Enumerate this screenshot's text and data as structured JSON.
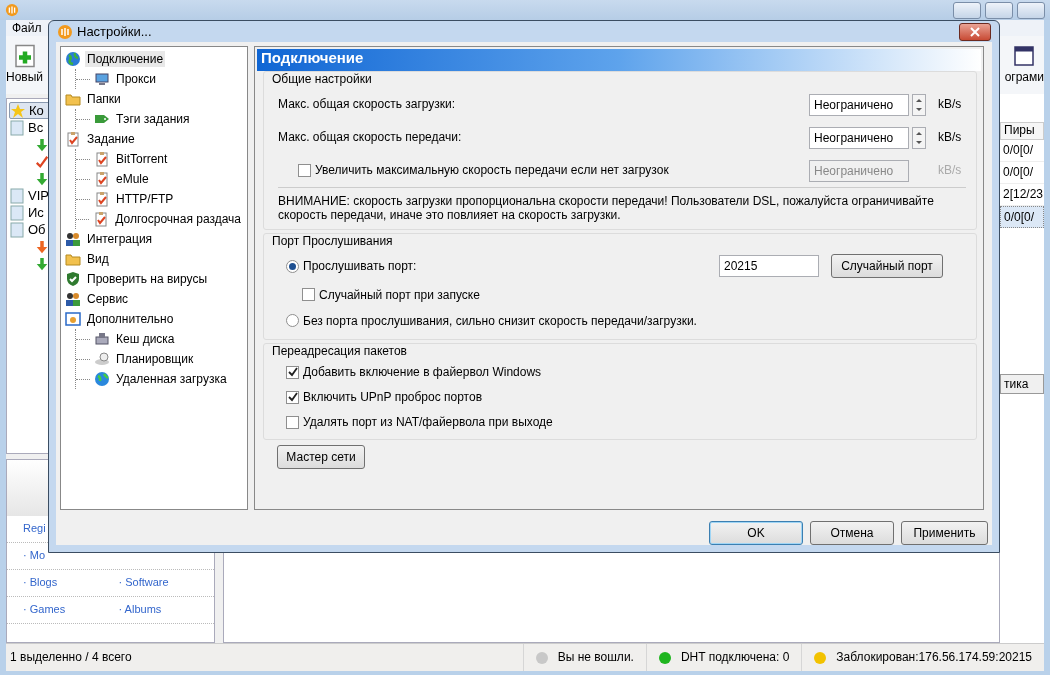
{
  "app": {
    "menu": [
      {
        "label": "Файл"
      }
    ],
    "toolbar": [
      {
        "label": "Новый"
      },
      {
        "label": "ограми"
      }
    ],
    "sidebar": {
      "items": [
        {
          "label": "Ко",
          "selected": true
        },
        {
          "label": "Вс",
          "selected": false
        },
        {
          "label": "VIP",
          "selected": false
        },
        {
          "label": "Ис",
          "selected": false
        },
        {
          "label": "Об",
          "selected": false
        }
      ]
    },
    "table": {
      "columns": [
        {
          "label": "Пиры"
        }
      ],
      "rows": [
        {
          "cell": "0/0[0/",
          "selected": false
        },
        {
          "cell": "0/0[0/",
          "selected": false
        },
        {
          "cell": "2[12/23",
          "selected": false
        },
        {
          "cell": "0/0[0/",
          "selected": true
        }
      ]
    },
    "tab": {
      "label": "тика"
    },
    "links": [
      [
        "Regi"
      ],
      [
        "· Mo"
      ],
      [
        "· Blogs",
        "· Software"
      ],
      [
        "· Games",
        "· Albums"
      ]
    ],
    "status_bar": {
      "selection": "1 выделенно / 4 всего",
      "items": [
        {
          "text": "Вы не вошли.",
          "color": "#c8c8c8"
        },
        {
          "text": "DHT подключена: 0",
          "color": "#1fb51f"
        },
        {
          "text": "Заблокирован:176.56.174.59:20215",
          "color": "#f2c200"
        }
      ]
    }
  },
  "dialog": {
    "title": "Настройки...",
    "tree": [
      {
        "label": "Подключение",
        "selected": true,
        "children": [
          {
            "label": "Прокси",
            "selected": false
          }
        ]
      },
      {
        "label": "Папки",
        "selected": false,
        "children": [
          {
            "label": "Тэги задания",
            "selected": false
          }
        ]
      },
      {
        "label": "Задание",
        "selected": false,
        "children": [
          {
            "label": "BitTorrent",
            "selected": false
          },
          {
            "label": "eMule",
            "selected": false
          },
          {
            "label": "HTTP/FTP",
            "selected": false
          },
          {
            "label": "Долгосрочная раздача",
            "selected": false
          }
        ]
      },
      {
        "label": "Интеграция",
        "selected": false
      },
      {
        "label": "Вид",
        "selected": false
      },
      {
        "label": "Проверить на вирусы",
        "selected": false
      },
      {
        "label": "Сервис",
        "selected": false
      },
      {
        "label": "Дополнительно",
        "selected": false,
        "children": [
          {
            "label": "Кеш диска",
            "selected": false
          },
          {
            "label": "Планировщик",
            "selected": false
          },
          {
            "label": "Удаленная загрузка",
            "selected": false
          }
        ]
      }
    ],
    "panel_title": "Подключение",
    "general": {
      "title": "Общие настройки",
      "rows": [
        {
          "kind": "speed",
          "label": "Макс. общая скорость загрузки:",
          "value": "Неограничено",
          "unit": "kB/s",
          "disabled": false
        },
        {
          "kind": "speed",
          "label": "Макс. общая скорость передачи:",
          "value": "Неограничено",
          "unit": "kB/s",
          "disabled": false
        },
        {
          "kind": "check",
          "label": "Увеличить максимальную скорость передачи если нет загрузок",
          "checked": false,
          "value": "Неограничено",
          "unit": "kB/s",
          "disabled": true
        }
      ],
      "warning": "ВНИМАНИЕ: скорость загрузки пропорциональна скорости передачи! Пользователи DSL, пожалуйста ограничивайте скорость передачи, иначе это повлияет на скорость загрузки."
    },
    "port": {
      "title": "Порт Прослушивания",
      "listen": {
        "label": "Прослушивать порт:",
        "selected": true
      },
      "port_value": "20215",
      "random_button": "Случайный порт",
      "random_on_start": {
        "label": "Случайный порт при запуске",
        "checked": false
      },
      "no_port": {
        "label": "Без порта прослушивания, сильно снизит скорость передачи/загрузки.",
        "selected": false
      }
    },
    "forwarding": {
      "title": "Переадресация пакетов",
      "options": [
        {
          "label": "Добавить включение в файервол Windows",
          "checked": true
        },
        {
          "label": "Включить UPnP проброс портов",
          "checked": true
        },
        {
          "label": "Удалять порт из NAT/файервола при выходе",
          "checked": false
        }
      ]
    },
    "wizard_button": "Мастер сети",
    "buttons": [
      {
        "label": "OK",
        "default": true
      },
      {
        "label": "Отмена",
        "default": false
      },
      {
        "label": "Применить",
        "default": false
      }
    ]
  }
}
